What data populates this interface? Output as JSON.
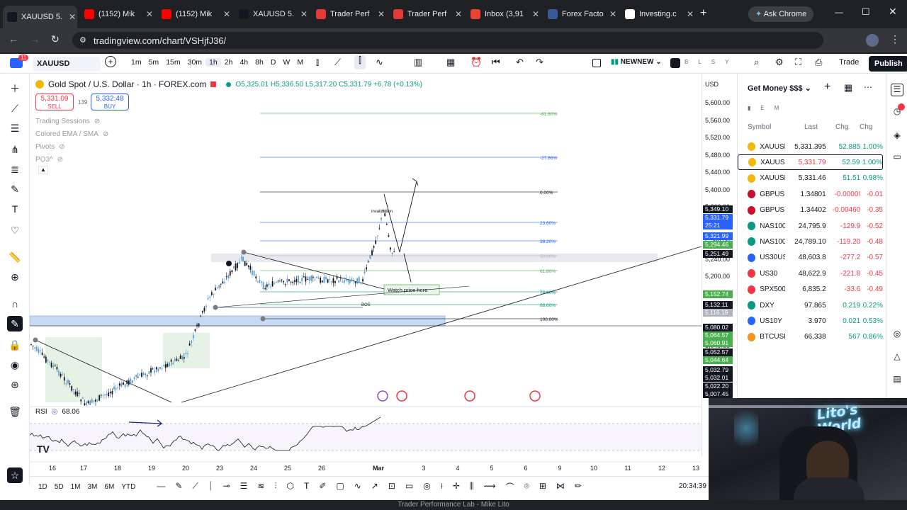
{
  "browser": {
    "tabs": [
      {
        "label": "XAUUSD 5.",
        "icon": "tradingview-icon",
        "active": true
      },
      {
        "label": "(1152) Mik",
        "icon": "youtube-icon"
      },
      {
        "label": "(1152) Mik",
        "icon": "youtube-icon"
      },
      {
        "label": "XAUUSD 5.",
        "icon": "tradingview-icon"
      },
      {
        "label": "Trader Perf",
        "icon": "sk-icon"
      },
      {
        "label": "Trader Perf",
        "icon": "pin-icon"
      },
      {
        "label": "Inbox (3,91",
        "icon": "gmail-icon"
      },
      {
        "label": "Forex Facto",
        "icon": "ff-icon"
      },
      {
        "label": "Investing.c",
        "icon": "investing-icon"
      }
    ],
    "ask_chrome": "Ask Chrome",
    "url": "tradingview.com/chart/VSHjfJ36/"
  },
  "toolbar": {
    "symbol": "XAUUSD",
    "notification_count": "11",
    "intervals": [
      "1m",
      "5m",
      "15m",
      "30m",
      "1h",
      "2h",
      "4h",
      "8h",
      "D",
      "W",
      "M"
    ],
    "active_interval": "1h",
    "layout_name": "NEWNEW",
    "layout_letters": [
      "B",
      "L",
      "S",
      "Y"
    ],
    "trade": "Trade",
    "publish": "Publish"
  },
  "legend": {
    "title": "Gold Spot / U.S. Dollar · 1h · FOREX.com",
    "ohlc": "O5,325.01 H5,336.50 L5,317.20 C5,331.79 +6.78 (+0.13%)",
    "sell_price": "5,331.09",
    "sell_label": "SELL",
    "spread": "139",
    "buy_price": "5,332.48",
    "buy_label": "BUY",
    "indicators": [
      "Trading Sessions",
      "Colored EMA / SMA",
      "Pivots",
      "PO3^"
    ]
  },
  "chart": {
    "currency": "USD",
    "price_ticks": [
      "5,600.00",
      "5,560.00",
      "5,520.00",
      "5,480.00",
      "5,440.00",
      "5,400.00",
      "5,360.00",
      "5,320.00",
      "5,280.00",
      "5,240.00",
      "5,200.00",
      "5,160.00",
      "5,120.00",
      "5,080.00",
      "5,040.00"
    ],
    "price_badges": [
      {
        "v": "5,349.10",
        "c": "#131722"
      },
      {
        "v": "5,331.79",
        "c": "#2962ff"
      },
      {
        "v": "25:21",
        "c": "#2962ff"
      },
      {
        "v": "5,321.99",
        "c": "#2962ff"
      },
      {
        "v": "5,294.46",
        "c": "#4caf50"
      },
      {
        "v": "5,251.49",
        "c": "#131722"
      },
      {
        "v": "5,152.74",
        "c": "#4caf50"
      },
      {
        "v": "5,132.11",
        "c": "#131722"
      },
      {
        "v": "5,116.19",
        "c": "#b2b5be"
      },
      {
        "v": "5,080.02",
        "c": "#131722"
      },
      {
        "v": "5,064.57",
        "c": "#4caf50"
      },
      {
        "v": "5,060.91",
        "c": "#4caf50"
      },
      {
        "v": "5,052.57",
        "c": "#131722"
      },
      {
        "v": "5,044.64",
        "c": "#4caf50"
      },
      {
        "v": "5,032.79",
        "c": "#131722"
      },
      {
        "v": "5,032.01",
        "c": "#131722"
      },
      {
        "v": "5,022.20",
        "c": "#131722"
      },
      {
        "v": "5,007.45",
        "c": "#131722"
      }
    ],
    "fib_labels": [
      "-61.80%",
      "-27.86%",
      "0.00%",
      "23.60%",
      "38.20%",
      "50.00%",
      "61.80%",
      "78.60%",
      "88.60%",
      "100.00%"
    ],
    "annotations": {
      "invalidation": "invalidation",
      "watch": "Watch price here",
      "bos": "BOS"
    },
    "date_ticks": [
      "16",
      "17",
      "18",
      "19",
      "20",
      "23",
      "24",
      "25",
      "26",
      "Mar",
      "3",
      "4",
      "5",
      "6",
      "9",
      "10",
      "11",
      "12",
      "13"
    ],
    "rsi_label": "RSI",
    "rsi_value": "68.06"
  },
  "bottom": {
    "ranges": [
      "1D",
      "5D",
      "1M",
      "3M",
      "6M",
      "YTD"
    ],
    "time": "20:34:39"
  },
  "watchlist": {
    "title": "Get Money $$$",
    "flags": [
      "E",
      "M"
    ],
    "headers": [
      "Symbol",
      "Last",
      "Chg",
      "Chg"
    ],
    "rows": [
      {
        "sym": "XAUUSE",
        "last": "5,331.395",
        "chg": "52.885",
        "chp": "1.00%",
        "dir": "up",
        "color": "#f0b90b"
      },
      {
        "sym": "XAUUSE",
        "last": "5,331.79",
        "chg": "52.59",
        "chp": "1.00%",
        "dir": "up",
        "color": "#f0b90b"
      },
      {
        "sym": "XAUUSE",
        "last": "5,331.46",
        "chg": "51.51",
        "chp": "0.98%",
        "dir": "up",
        "color": "#f0b90b"
      },
      {
        "sym": "GBPUSE",
        "last": "1.34801",
        "chg": "-0.0000!",
        "chp": "-0.01",
        "dir": "dn",
        "color": "#c8102e"
      },
      {
        "sym": "GBPUSE",
        "last": "1.34402",
        "chg": "-0.00460",
        "chp": "-0.35",
        "dir": "dn",
        "color": "#c8102e"
      },
      {
        "sym": "NAS100",
        "last": "24,795.9",
        "chg": "-129.9",
        "chp": "-0.52",
        "dir": "dn",
        "color": "#089981"
      },
      {
        "sym": "NAS100",
        "last": "24,789.10",
        "chg": "-119.20",
        "chp": "-0.48",
        "dir": "dn",
        "color": "#089981"
      },
      {
        "sym": "US30US",
        "last": "48,603.8",
        "chg": "-277.2",
        "chp": "-0.57",
        "dir": "dn",
        "color": "#2962ff"
      },
      {
        "sym": "US30",
        "last": "48,622.9",
        "chg": "-221.8",
        "chp": "-0.45",
        "dir": "dn",
        "color": "#f23645"
      },
      {
        "sym": "SPX500",
        "last": "6,835.2",
        "chg": "-33.6",
        "chp": "-0.49",
        "dir": "dn",
        "color": "#f23645"
      },
      {
        "sym": "DXY",
        "last": "97.865",
        "chg": "0.219",
        "chp": "0.22%",
        "dir": "up",
        "color": "#089981"
      },
      {
        "sym": "US10Y",
        "last": "3.970",
        "chg": "0.021",
        "chp": "0.53%",
        "dir": "up",
        "color": "#2962ff"
      },
      {
        "sym": "BTCUSE",
        "last": "66,338",
        "chg": "567",
        "chp": "0.86%",
        "dir": "up",
        "color": "#f7931a"
      }
    ]
  },
  "webcam": {
    "neon_text": "Lito's World"
  },
  "footer": "Trader Performance Lab - Mike Lito"
}
